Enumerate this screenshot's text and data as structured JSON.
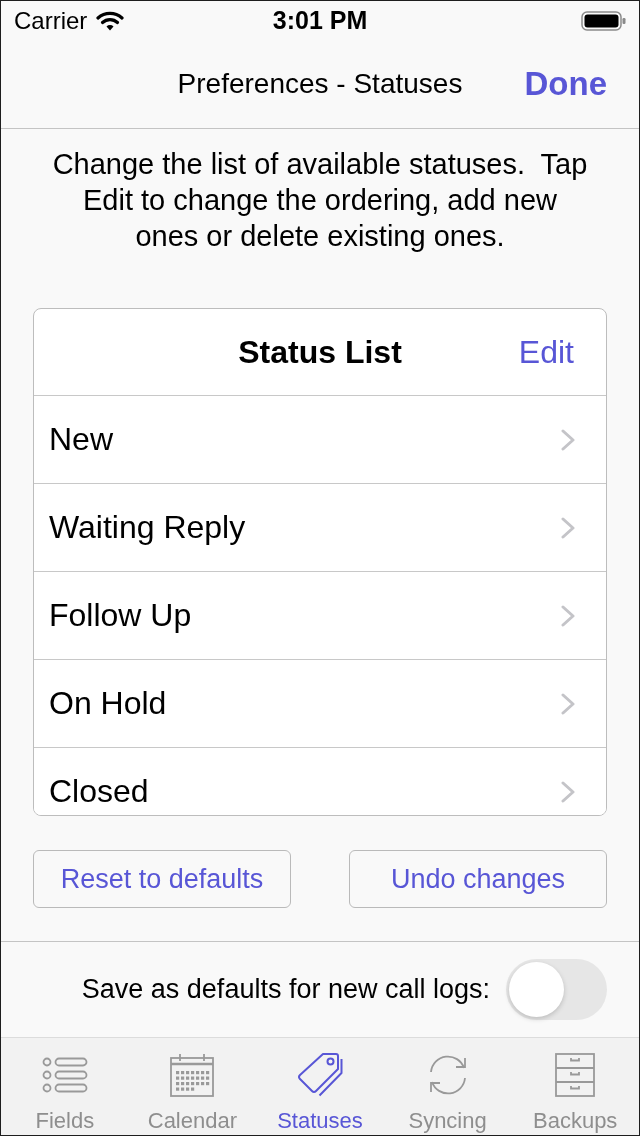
{
  "status_bar": {
    "carrier": "Carrier",
    "time": "3:01 PM"
  },
  "nav_bar": {
    "title": "Preferences - Statuses",
    "done_button": "Done"
  },
  "description": "Change the list of available statuses.  Tap Edit to change the ordering, add new ones or delete existing ones.",
  "status_list": {
    "title": "Status List",
    "edit_button": "Edit",
    "items": [
      {
        "label": "New"
      },
      {
        "label": "Waiting Reply"
      },
      {
        "label": "Follow Up"
      },
      {
        "label": "On Hold"
      },
      {
        "label": "Closed"
      }
    ]
  },
  "buttons": [
    {
      "label": "Reset to defaults"
    },
    {
      "label": "Undo changes"
    }
  ],
  "default_toggle": {
    "label": "Save as defaults for new call logs:",
    "on": false
  },
  "tab_bar": [
    {
      "label": "Fields",
      "kind": "list",
      "selected": false
    },
    {
      "label": "Calendar",
      "kind": "calendar",
      "selected": false
    },
    {
      "label": "Statuses",
      "kind": "tag",
      "selected": true
    },
    {
      "label": "Syncing",
      "kind": "sync",
      "selected": false
    },
    {
      "label": "Backups",
      "kind": "cabinet",
      "selected": false
    }
  ]
}
